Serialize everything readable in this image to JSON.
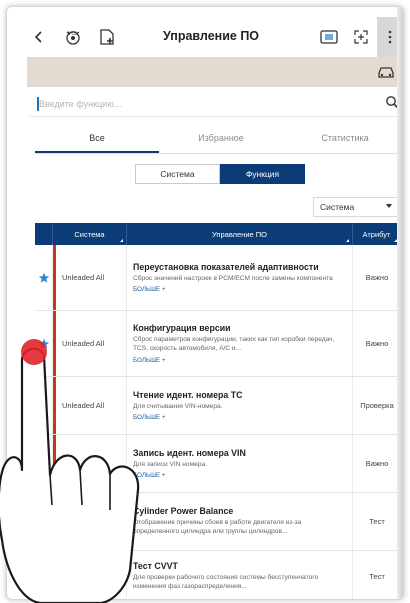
{
  "header": {
    "title": "Управление ПО",
    "icons": [
      "back-icon",
      "vci-icon",
      "add-file-icon",
      "tablet-icon",
      "expand-icon",
      "more-icon",
      "car-icon",
      "search-icon"
    ]
  },
  "search": {
    "placeholder": "Введите функцию..."
  },
  "tabs": [
    {
      "label": "Все"
    },
    {
      "label": "Избранное"
    },
    {
      "label": "Статистика"
    }
  ],
  "segment": {
    "left": "Система",
    "right": "Функция"
  },
  "dropdown": {
    "value": "Система"
  },
  "table": {
    "headers": [
      "Система",
      "Управление ПО",
      "Атрибут"
    ],
    "more_label": "БОЛЬШЕ +",
    "rows": [
      {
        "starred": true,
        "system": "Unleaded All",
        "name": "Переустановка показателей адаптивности",
        "desc": "Сброс значений настроек в PCM/ECM после замены компонента",
        "attr": "Важно"
      },
      {
        "starred": true,
        "system": "Unleaded All",
        "name": "Конфигурация версии",
        "desc": "Сброс параметров конфигурации, таких как тип коробки передач, TCS, скорость автомобиля, A/C и...",
        "attr": "Важно"
      },
      {
        "starred": false,
        "system": "Unleaded All",
        "name": "Чтение идент. номера ТС",
        "desc": "Для считывания VIN-номера.",
        "attr": "Проверка"
      },
      {
        "starred": false,
        "system": "",
        "name": "Запись идент. номера VIN",
        "desc": "Для записи VIN номера.",
        "attr": "Важно"
      },
      {
        "starred": false,
        "system": "",
        "name": "Cylinder Power Balance",
        "desc": "Отображение причины сбоев в работе двигателя из-за определенного цилиндра или группы цилиндров...",
        "attr": "Тест"
      },
      {
        "starred": false,
        "system": "",
        "name": "Тест CVVT",
        "desc": "Для проверки рабочего состояния системы бесступенчатого изменения фаз газораспределения...",
        "attr": "Тест"
      }
    ]
  },
  "colors": {
    "accent": "#0c3c78",
    "row_marker": "#c8371c",
    "star": "#2a8ad8",
    "touch": "#e0242a",
    "vehicle_bar": "#e4dbd0"
  }
}
